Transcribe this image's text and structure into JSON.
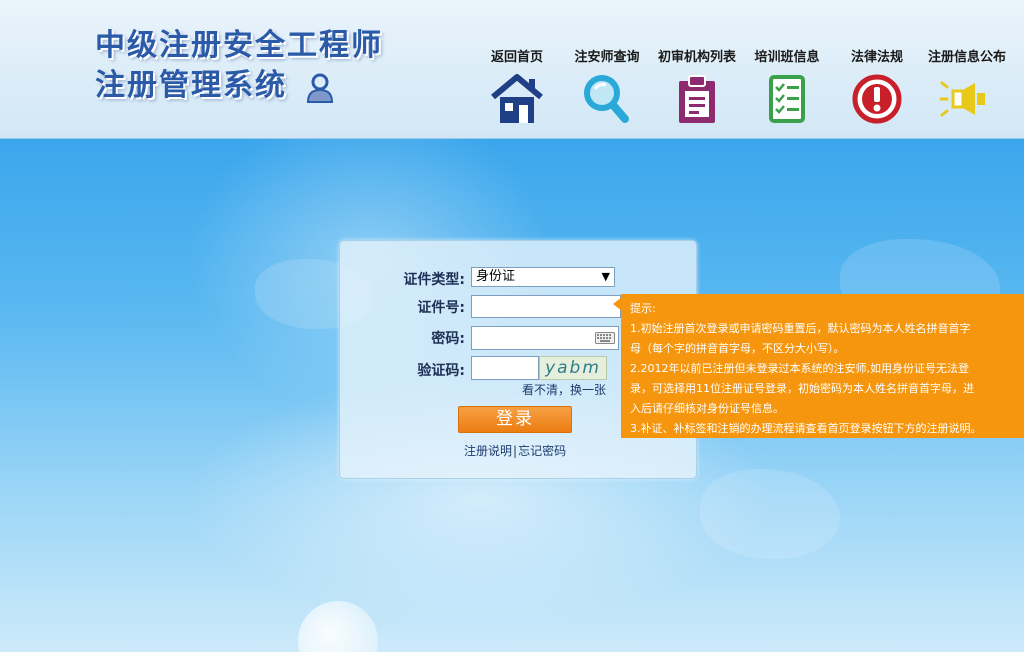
{
  "logo": {
    "line1": "中级注册安全工程师",
    "line2": "注册管理系统"
  },
  "nav": [
    {
      "label": "返回首页",
      "icon": "home-icon",
      "color": "#1f3f86"
    },
    {
      "label": "注安师查询",
      "icon": "search-icon",
      "color": "#2aa8d8"
    },
    {
      "label": "初审机构列表",
      "icon": "clipboard-icon",
      "color": "#8e2a6e"
    },
    {
      "label": "培训班信息",
      "icon": "checklist-icon",
      "color": "#3aa14a"
    },
    {
      "label": "法律法规",
      "icon": "alert-icon",
      "color": "#c8202a"
    },
    {
      "label": "注册信息公布",
      "icon": "megaphone-icon",
      "color": "#e8c91a"
    }
  ],
  "login": {
    "cert_type_label": "证件类型:",
    "cert_type_value": "身份证",
    "cert_no_label": "证件号:",
    "cert_no_value": "",
    "password_label": "密码:",
    "password_value": "",
    "captcha_label": "验证码:",
    "captcha_value": "",
    "captcha_text": "yabm",
    "refresh_text": "看不清，换一张",
    "login_button": "登录",
    "register_link": "注册说明",
    "forgot_link": "忘记密码"
  },
  "tip": {
    "title": "提示:",
    "line1": "1.初始注册首次登录或申请密码重置后，默认密码为本人姓名拼音首字",
    "line2": "母（每个字的拼音首字母，不区分大小写）。",
    "line3": "2.2012年以前已注册但未登录过本系统的注安师,如用身份证号无法登",
    "line4": "录，可选择用11位注册证号登录，初始密码为本人姓名拼音首字母，进",
    "line5": "入后请仔细核对身份证号信息。",
    "line6": "3.补证、补标签和注销的办理流程请查看首页登录按钮下方的注册说明。"
  },
  "colors": {
    "accent_orange": "#f6960e",
    "header_title": "#2a5aa8",
    "button": "#ec7d12"
  }
}
